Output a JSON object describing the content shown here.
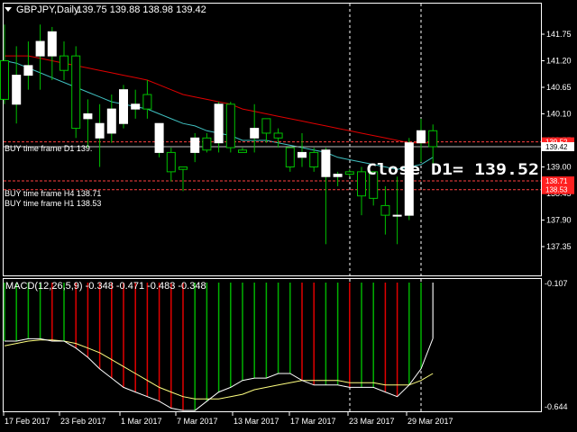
{
  "window": {
    "symbol_line": "GBPJPY,Daily",
    "ohlc_line": "139.75 139.88 138.98 139.42"
  },
  "price_axis": {
    "ticks": [
      "141.75",
      "141.20",
      "140.65",
      "140.10",
      "139.55",
      "139.00",
      "138.45",
      "137.90",
      "137.35"
    ],
    "close_tag": "139.42",
    "red_tags": [
      "139.52",
      "138.71",
      "138.53"
    ]
  },
  "levels": [
    {
      "label": "BUY  time frame D1 139.",
      "price": 139.52
    },
    {
      "label": "BUY  time frame H4 138.71",
      "price": 138.71
    },
    {
      "label": "BUY  time frame H1 138.53",
      "price": 138.53
    }
  ],
  "close_d1_label": "Close D1= 139.52",
  "macd": {
    "title": "MACD(12,26,5,9) -0.348 -0.471 -0.483 -0.348",
    "axis_top": "-0.107",
    "axis_bottom": "-0.644"
  },
  "date_axis": [
    "17 Feb 2017",
    "23 Feb 2017",
    "1 Mar 2017",
    "7 Mar 2017",
    "13 Mar 2017",
    "17 Mar 2017",
    "23 Mar 2017",
    "29 Mar 2017"
  ],
  "colors": {
    "background": "#000000",
    "bull": "#ffffff",
    "wick": "#00c000",
    "ma_slow": "#e00000",
    "ma_fast": "#40c0c0",
    "level_line": "#ff4040",
    "macd_up": "#00b000",
    "macd_down": "#e00000",
    "signal": "#ffff80",
    "macd_line": "#ffffff"
  },
  "chart_data": {
    "type": "candlestick",
    "candles": [
      {
        "o": 141.2,
        "h": 141.95,
        "l": 140.3,
        "c": 140.4
      },
      {
        "o": 140.3,
        "h": 141.5,
        "l": 139.9,
        "c": 140.9
      },
      {
        "o": 140.9,
        "h": 141.6,
        "l": 140.6,
        "c": 141.1
      },
      {
        "o": 141.3,
        "h": 141.95,
        "l": 140.6,
        "c": 141.6
      },
      {
        "o": 141.3,
        "h": 141.9,
        "l": 140.8,
        "c": 141.8
      },
      {
        "o": 141.3,
        "h": 141.6,
        "l": 140.8,
        "c": 141.0
      },
      {
        "o": 141.3,
        "h": 141.5,
        "l": 139.6,
        "c": 139.8
      },
      {
        "o": 140.0,
        "h": 140.4,
        "l": 139.4,
        "c": 140.1
      },
      {
        "o": 139.6,
        "h": 140.3,
        "l": 139.0,
        "c": 139.9
      },
      {
        "o": 139.7,
        "h": 140.5,
        "l": 139.5,
        "c": 140.2
      },
      {
        "o": 139.9,
        "h": 140.7,
        "l": 139.8,
        "c": 140.6
      },
      {
        "o": 140.2,
        "h": 140.6,
        "l": 140.0,
        "c": 140.3
      },
      {
        "o": 140.5,
        "h": 140.8,
        "l": 140.0,
        "c": 140.2
      },
      {
        "o": 139.3,
        "h": 139.9,
        "l": 139.2,
        "c": 139.9
      },
      {
        "o": 139.3,
        "h": 139.4,
        "l": 138.7,
        "c": 138.9
      },
      {
        "o": 139.0,
        "h": 139.0,
        "l": 138.5,
        "c": 138.95
      },
      {
        "o": 139.3,
        "h": 139.7,
        "l": 139.1,
        "c": 139.6
      },
      {
        "o": 139.6,
        "h": 139.7,
        "l": 139.3,
        "c": 139.35
      },
      {
        "o": 139.5,
        "h": 140.35,
        "l": 139.3,
        "c": 140.3
      },
      {
        "o": 140.3,
        "h": 140.35,
        "l": 139.3,
        "c": 139.4
      },
      {
        "o": 139.35,
        "h": 139.4,
        "l": 139.3,
        "c": 139.3
      },
      {
        "o": 139.6,
        "h": 140.3,
        "l": 139.3,
        "c": 139.8
      },
      {
        "o": 140.0,
        "h": 140.0,
        "l": 139.5,
        "c": 139.7
      },
      {
        "o": 139.7,
        "h": 139.8,
        "l": 139.4,
        "c": 139.6
      },
      {
        "o": 139.4,
        "h": 139.4,
        "l": 138.9,
        "c": 139.0
      },
      {
        "o": 139.2,
        "h": 139.7,
        "l": 139.0,
        "c": 139.3
      },
      {
        "o": 139.3,
        "h": 139.4,
        "l": 138.9,
        "c": 139.0
      },
      {
        "o": 138.8,
        "h": 139.4,
        "l": 137.4,
        "c": 139.35
      },
      {
        "o": 138.8,
        "h": 138.9,
        "l": 138.6,
        "c": 138.85
      },
      {
        "o": 138.9,
        "h": 138.95,
        "l": 138.8,
        "c": 138.85
      },
      {
        "o": 138.9,
        "h": 139.0,
        "l": 138.0,
        "c": 138.4
      },
      {
        "o": 138.9,
        "h": 138.9,
        "l": 138.2,
        "c": 138.35
      },
      {
        "o": 138.2,
        "h": 138.6,
        "l": 137.6,
        "c": 138.0
      },
      {
        "o": 138.0,
        "h": 138.8,
        "l": 137.4,
        "c": 138.0
      },
      {
        "o": 138.0,
        "h": 139.6,
        "l": 137.9,
        "c": 139.5
      },
      {
        "o": 139.5,
        "h": 140.0,
        "l": 139.1,
        "c": 139.75
      },
      {
        "o": 139.75,
        "h": 139.88,
        "l": 138.98,
        "c": 139.42
      }
    ],
    "ma_slow": [
      141.3,
      141.3,
      141.3,
      141.25,
      141.2,
      141.15,
      141.1,
      141.05,
      141.0,
      140.95,
      140.9,
      140.85,
      140.8,
      140.7,
      140.6,
      140.5,
      140.45,
      140.4,
      140.35,
      140.3,
      140.2,
      140.15,
      140.1,
      140.05,
      140.0,
      139.95,
      139.9,
      139.85,
      139.8,
      139.75,
      139.7,
      139.65,
      139.6,
      139.55,
      139.5,
      139.5,
      139.5
    ],
    "ma_fast": [
      141.2,
      141.15,
      141.05,
      140.95,
      140.85,
      140.75,
      140.65,
      140.55,
      140.45,
      140.35,
      140.3,
      140.25,
      140.2,
      140.1,
      140.0,
      139.9,
      139.85,
      139.75,
      139.7,
      139.65,
      139.55,
      139.55,
      139.55,
      139.5,
      139.45,
      139.4,
      139.35,
      139.3,
      139.2,
      139.15,
      139.1,
      139.05,
      139.0,
      138.95,
      139.0,
      139.05,
      139.2
    ],
    "macd_hist": [
      -0.36,
      -0.36,
      -0.35,
      -0.35,
      -0.36,
      -0.36,
      -0.39,
      -0.43,
      -0.48,
      -0.52,
      -0.56,
      -0.58,
      -0.6,
      -0.62,
      -0.65,
      -0.66,
      -0.66,
      -0.62,
      -0.58,
      -0.56,
      -0.53,
      -0.52,
      -0.52,
      -0.5,
      -0.5,
      -0.53,
      -0.55,
      -0.55,
      -0.55,
      -0.56,
      -0.56,
      -0.56,
      -0.58,
      -0.6,
      -0.55,
      -0.48,
      -0.348
    ],
    "macd_signal": [
      -0.38,
      -0.37,
      -0.36,
      -0.355,
      -0.355,
      -0.36,
      -0.37,
      -0.39,
      -0.41,
      -0.44,
      -0.47,
      -0.5,
      -0.53,
      -0.56,
      -0.58,
      -0.6,
      -0.61,
      -0.61,
      -0.61,
      -0.6,
      -0.59,
      -0.57,
      -0.56,
      -0.55,
      -0.54,
      -0.53,
      -0.53,
      -0.53,
      -0.53,
      -0.54,
      -0.54,
      -0.54,
      -0.55,
      -0.55,
      -0.55,
      -0.53,
      -0.5
    ],
    "price_ylim": [
      137.3,
      141.95
    ],
    "macd_ylim": [
      -0.644,
      -0.107
    ]
  }
}
